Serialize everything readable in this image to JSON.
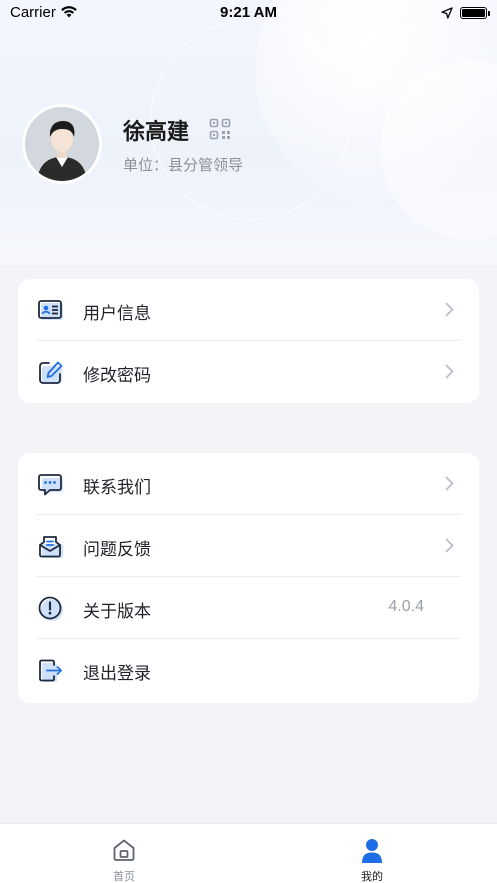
{
  "status_bar": {
    "carrier": "Carrier",
    "time": "9:21 AM",
    "wifi_icon": "wifi-icon",
    "location_icon": "location-arrow-icon",
    "battery_icon": "battery-icon"
  },
  "profile": {
    "name": "徐高建",
    "department": "单位：县分管领导",
    "avatar_icon": "avatar-icon",
    "qr_icon": "qr-code-icon"
  },
  "menu_group_1": [
    {
      "label": "用户信息",
      "icon": "id-card-icon"
    },
    {
      "label": "修改密码",
      "icon": "edit-icon"
    }
  ],
  "menu_group_2": [
    {
      "label": "联系我们",
      "icon": "chat-icon"
    },
    {
      "label": "问题反馈",
      "icon": "mail-icon"
    },
    {
      "label": "关于版本",
      "icon": "info-icon",
      "value": "4.0.4"
    },
    {
      "label": "退出登录",
      "icon": "logout-icon"
    }
  ],
  "tabbar": {
    "home_label": "首页",
    "mine_label": "我的",
    "active": "我的"
  },
  "colors": {
    "accent": "#1e6fe6",
    "background": "#f2f4f8",
    "card": "#ffffff"
  }
}
